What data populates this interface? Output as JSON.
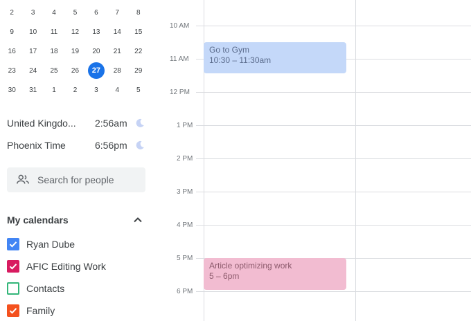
{
  "mini_calendar": {
    "weeks": [
      [
        "2",
        "3",
        "4",
        "5",
        "6",
        "7",
        "8"
      ],
      [
        "9",
        "10",
        "11",
        "12",
        "13",
        "14",
        "15"
      ],
      [
        "16",
        "17",
        "18",
        "19",
        "20",
        "21",
        "22"
      ],
      [
        "23",
        "24",
        "25",
        "26",
        "27",
        "28",
        "29"
      ],
      [
        "30",
        "31",
        "1",
        "2",
        "3",
        "4",
        "5"
      ]
    ],
    "today": "27"
  },
  "timezones": [
    {
      "name": "United Kingdo...",
      "time": "2:56am"
    },
    {
      "name": "Phoenix Time",
      "time": "6:56pm"
    }
  ],
  "search": {
    "placeholder": "Search for people"
  },
  "my_calendars": {
    "title": "My calendars",
    "items": [
      {
        "label": "Ryan Dube",
        "color": "#4285f4",
        "checked": true
      },
      {
        "label": "AFIC Editing Work",
        "color": "#d81b60",
        "checked": true
      },
      {
        "label": "Contacts",
        "color": "#33b679",
        "checked": false
      },
      {
        "label": "Family",
        "color": "#f4511e",
        "checked": true
      }
    ]
  },
  "hours": [
    "10 AM",
    "11 AM",
    "12 PM",
    "1 PM",
    "2 PM",
    "3 PM",
    "4 PM",
    "5 PM",
    "6 PM"
  ],
  "events": [
    {
      "title": "Go to Gym",
      "time": "10:30 – 11:30am",
      "color": "#c4d8f9"
    },
    {
      "title": "Article optimizing work",
      "time": "5 – 6pm",
      "color": "#f2bcd1"
    }
  ]
}
